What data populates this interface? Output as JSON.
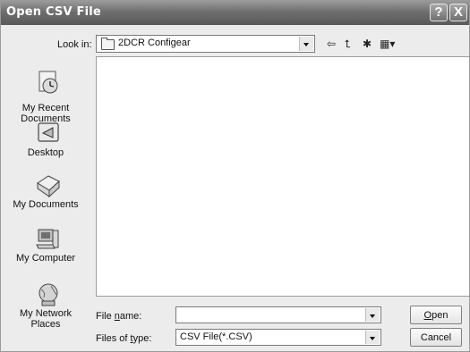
{
  "window": {
    "title": "Open CSV File",
    "help_glyph": "?",
    "close_glyph": "X"
  },
  "lookin": {
    "label": "Look in:",
    "value": "2DCR Configear",
    "folder_icon": "folder-icon"
  },
  "toolbar": {
    "back_glyph": "⇦",
    "up_glyph": "⮤",
    "new_folder_glyph": "✱",
    "views_glyph": "▦▾"
  },
  "places": [
    {
      "label": "My Recent\nDocuments",
      "icon": "recent-documents-icon"
    },
    {
      "label": "Desktop",
      "icon": "desktop-icon"
    },
    {
      "label": "My Documents",
      "icon": "my-documents-icon"
    },
    {
      "label": "My Computer",
      "icon": "my-computer-icon"
    },
    {
      "label": "My Network\nPlaces",
      "icon": "network-places-icon"
    }
  ],
  "filename": {
    "label_pre": "File ",
    "label_key": "n",
    "label_post": "ame:",
    "value": ""
  },
  "filetype": {
    "label_pre": "Files of ",
    "label_key": "t",
    "label_post": "ype:",
    "value": "CSV File(*.CSV)"
  },
  "buttons": {
    "open_key": "O",
    "open_rest": "pen",
    "cancel": "Cancel"
  }
}
